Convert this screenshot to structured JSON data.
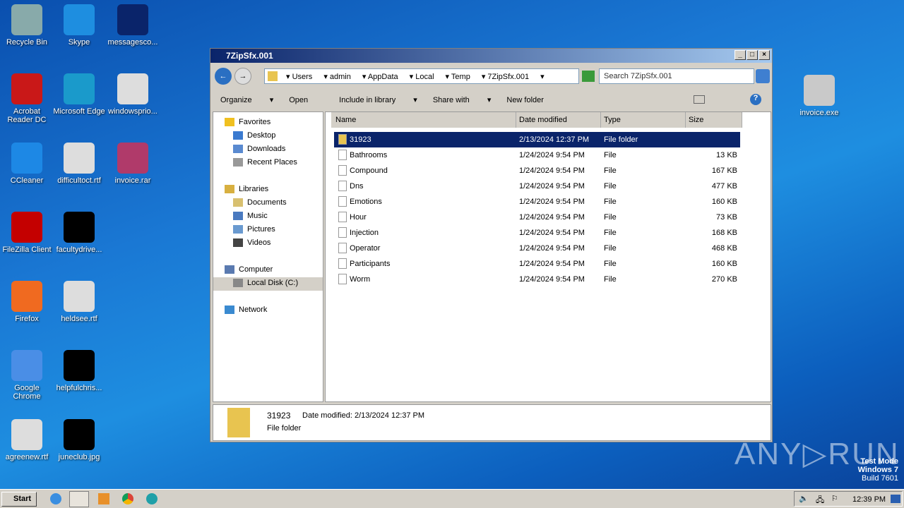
{
  "desktop": {
    "left": [
      "Recycle Bin",
      "Skype",
      "messagesco...",
      "Acrobat Reader DC",
      "Microsoft Edge",
      "windowsprio...",
      "CCleaner",
      "difficultoct.rtf",
      "invoice.rar",
      "FileZilla Client",
      "facultydrive...",
      "Firefox",
      "heldsee.rtf",
      "Google Chrome",
      "helpfulchris...",
      "agreenew.rtf",
      "juneclub.jpg"
    ],
    "right": "invoice.exe"
  },
  "window": {
    "title": "7ZipSfx.001",
    "breadcrumbs": [
      "Users",
      "admin",
      "AppData",
      "Local",
      "Temp",
      "7ZipSfx.001"
    ],
    "search_placeholder": "Search 7ZipSfx.001",
    "toolbar": [
      "Organize",
      "Open",
      "Include in library",
      "Share with",
      "New folder"
    ],
    "nav": {
      "favorites": "Favorites",
      "fav_items": [
        "Desktop",
        "Downloads",
        "Recent Places"
      ],
      "libraries": "Libraries",
      "lib_items": [
        "Documents",
        "Music",
        "Pictures",
        "Videos"
      ],
      "computer": "Computer",
      "local_disk": "Local Disk (C:)",
      "network": "Network"
    },
    "columns": [
      "Name",
      "Date modified",
      "Type",
      "Size"
    ],
    "files": [
      {
        "name": "31923",
        "date": "2/13/2024 12:37 PM",
        "type": "File folder",
        "size": ""
      },
      {
        "name": "Bathrooms",
        "date": "1/24/2024 9:54 PM",
        "type": "File",
        "size": "13 KB"
      },
      {
        "name": "Compound",
        "date": "1/24/2024 9:54 PM",
        "type": "File",
        "size": "167 KB"
      },
      {
        "name": "Dns",
        "date": "1/24/2024 9:54 PM",
        "type": "File",
        "size": "477 KB"
      },
      {
        "name": "Emotions",
        "date": "1/24/2024 9:54 PM",
        "type": "File",
        "size": "160 KB"
      },
      {
        "name": "Hour",
        "date": "1/24/2024 9:54 PM",
        "type": "File",
        "size": "73 KB"
      },
      {
        "name": "Injection",
        "date": "1/24/2024 9:54 PM",
        "type": "File",
        "size": "168 KB"
      },
      {
        "name": "Operator",
        "date": "1/24/2024 9:54 PM",
        "type": "File",
        "size": "468 KB"
      },
      {
        "name": "Participants",
        "date": "1/24/2024 9:54 PM",
        "type": "File",
        "size": "160 KB"
      },
      {
        "name": "Worm",
        "date": "1/24/2024 9:54 PM",
        "type": "File",
        "size": "270 KB"
      }
    ],
    "details": {
      "name": "31923",
      "modified": "Date modified: 2/13/2024 12:37 PM",
      "type": "File folder"
    }
  },
  "taskbar": {
    "start": "Start",
    "clock": "12:39 PM"
  },
  "watermark": {
    "brand": "ANY RUN",
    "mode": "Test Mode",
    "os": "Windows 7",
    "build": "Build 7601"
  }
}
